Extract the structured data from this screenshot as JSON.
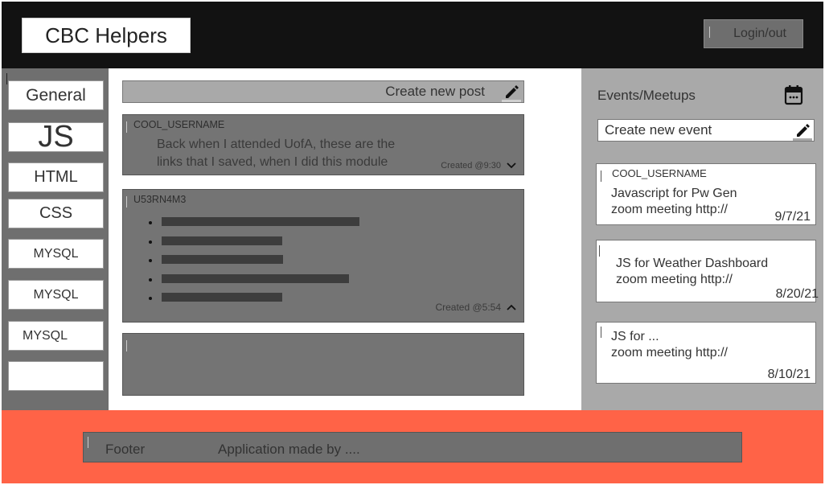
{
  "header": {
    "brand": "CBC Helpers",
    "login_label": "Login/out"
  },
  "sidebar": {
    "items": [
      {
        "label": "General"
      },
      {
        "label": "JS"
      },
      {
        "label": "HTML"
      },
      {
        "label": "CSS"
      },
      {
        "label": "MYSQL"
      },
      {
        "label": "MYSQL"
      },
      {
        "label": "MYSQL"
      },
      {
        "label": ""
      }
    ]
  },
  "main": {
    "new_post_label": "Create new post",
    "posts": [
      {
        "username": "COOL_USERNAME",
        "body_line1": "Back when I attended UofA, these are the",
        "body_line2": "links that I saved, when I did this module",
        "created": "Created @9:30"
      },
      {
        "username": "U53RN4M3",
        "created": "Created @5:54",
        "link_count": 5
      },
      {
        "username": ""
      }
    ]
  },
  "events": {
    "title": "Events/Meetups",
    "new_event_label": "Create new event",
    "items": [
      {
        "username": "COOL_USERNAME",
        "line1": "Javascript for Pw Gen",
        "line2": "zoom meeting http://",
        "date": "9/7/21"
      },
      {
        "username": "",
        "line1": "JS for Weather Dashboard",
        "line2": "zoom meeting http://",
        "date": "8/20/21"
      },
      {
        "username": "",
        "line1": "JS for ...",
        "line2": "zoom meeting http://",
        "date": "8/10/21"
      }
    ]
  },
  "footer": {
    "label": "Footer",
    "credit": "Application made by ...."
  },
  "colors": {
    "header_bg": "#121212",
    "sidebar_bg": "#6f6f6f",
    "events_bg": "#a9a9a9",
    "footer_bg": "#ff6347"
  },
  "icons": {
    "edit": "pencil-icon",
    "calendar": "calendar-icon",
    "expand": "chevron-down-icon",
    "collapse": "chevron-up-icon"
  }
}
